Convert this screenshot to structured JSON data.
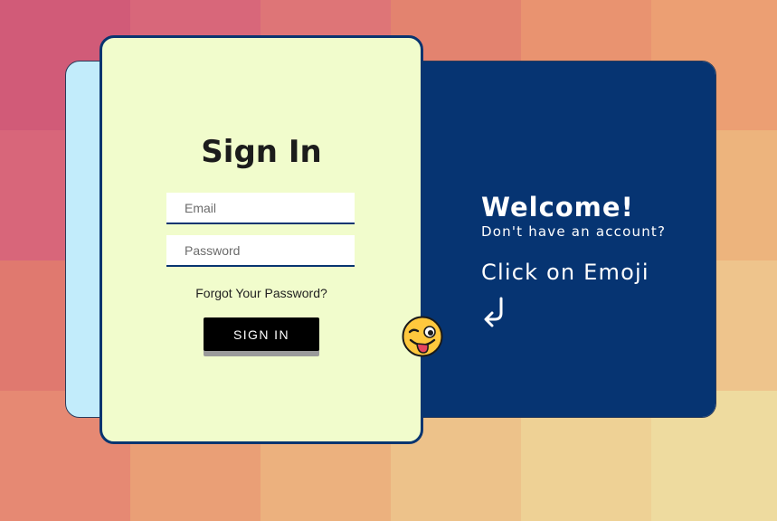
{
  "background": {
    "tiles": [
      "#d15b78",
      "#d8677a",
      "#de7577",
      "#e3836f",
      "#e99370",
      "#ec9f73",
      "#d8667a",
      "#e07a76",
      "#e68b72",
      "#ea9a6f",
      "#eca878",
      "#edb47d",
      "#e0796f",
      "#e6896f",
      "#eb9c72",
      "#ecae7b",
      "#edbc84",
      "#eec48c",
      "#e68973",
      "#ea9f76",
      "#ecb17e",
      "#edc28a",
      "#eed195",
      "#eedb9f"
    ]
  },
  "signin": {
    "title": "Sign In",
    "email_placeholder": "Email",
    "password_placeholder": "Password",
    "forgot_link": "Forgot Your Password?",
    "submit_label": "SIGN IN"
  },
  "welcome": {
    "title": "Welcome!",
    "subtitle": "Don't have an account?",
    "cta": "Click on Emoji",
    "arrow_icon": "return-arrow-icon"
  },
  "emoji": {
    "icon": "winking-tongue-emoji-icon"
  },
  "colors": {
    "navy": "#063472",
    "light_blue": "#c2ecfb",
    "card_bg": "#f1fccc",
    "button_bg": "#000000"
  }
}
